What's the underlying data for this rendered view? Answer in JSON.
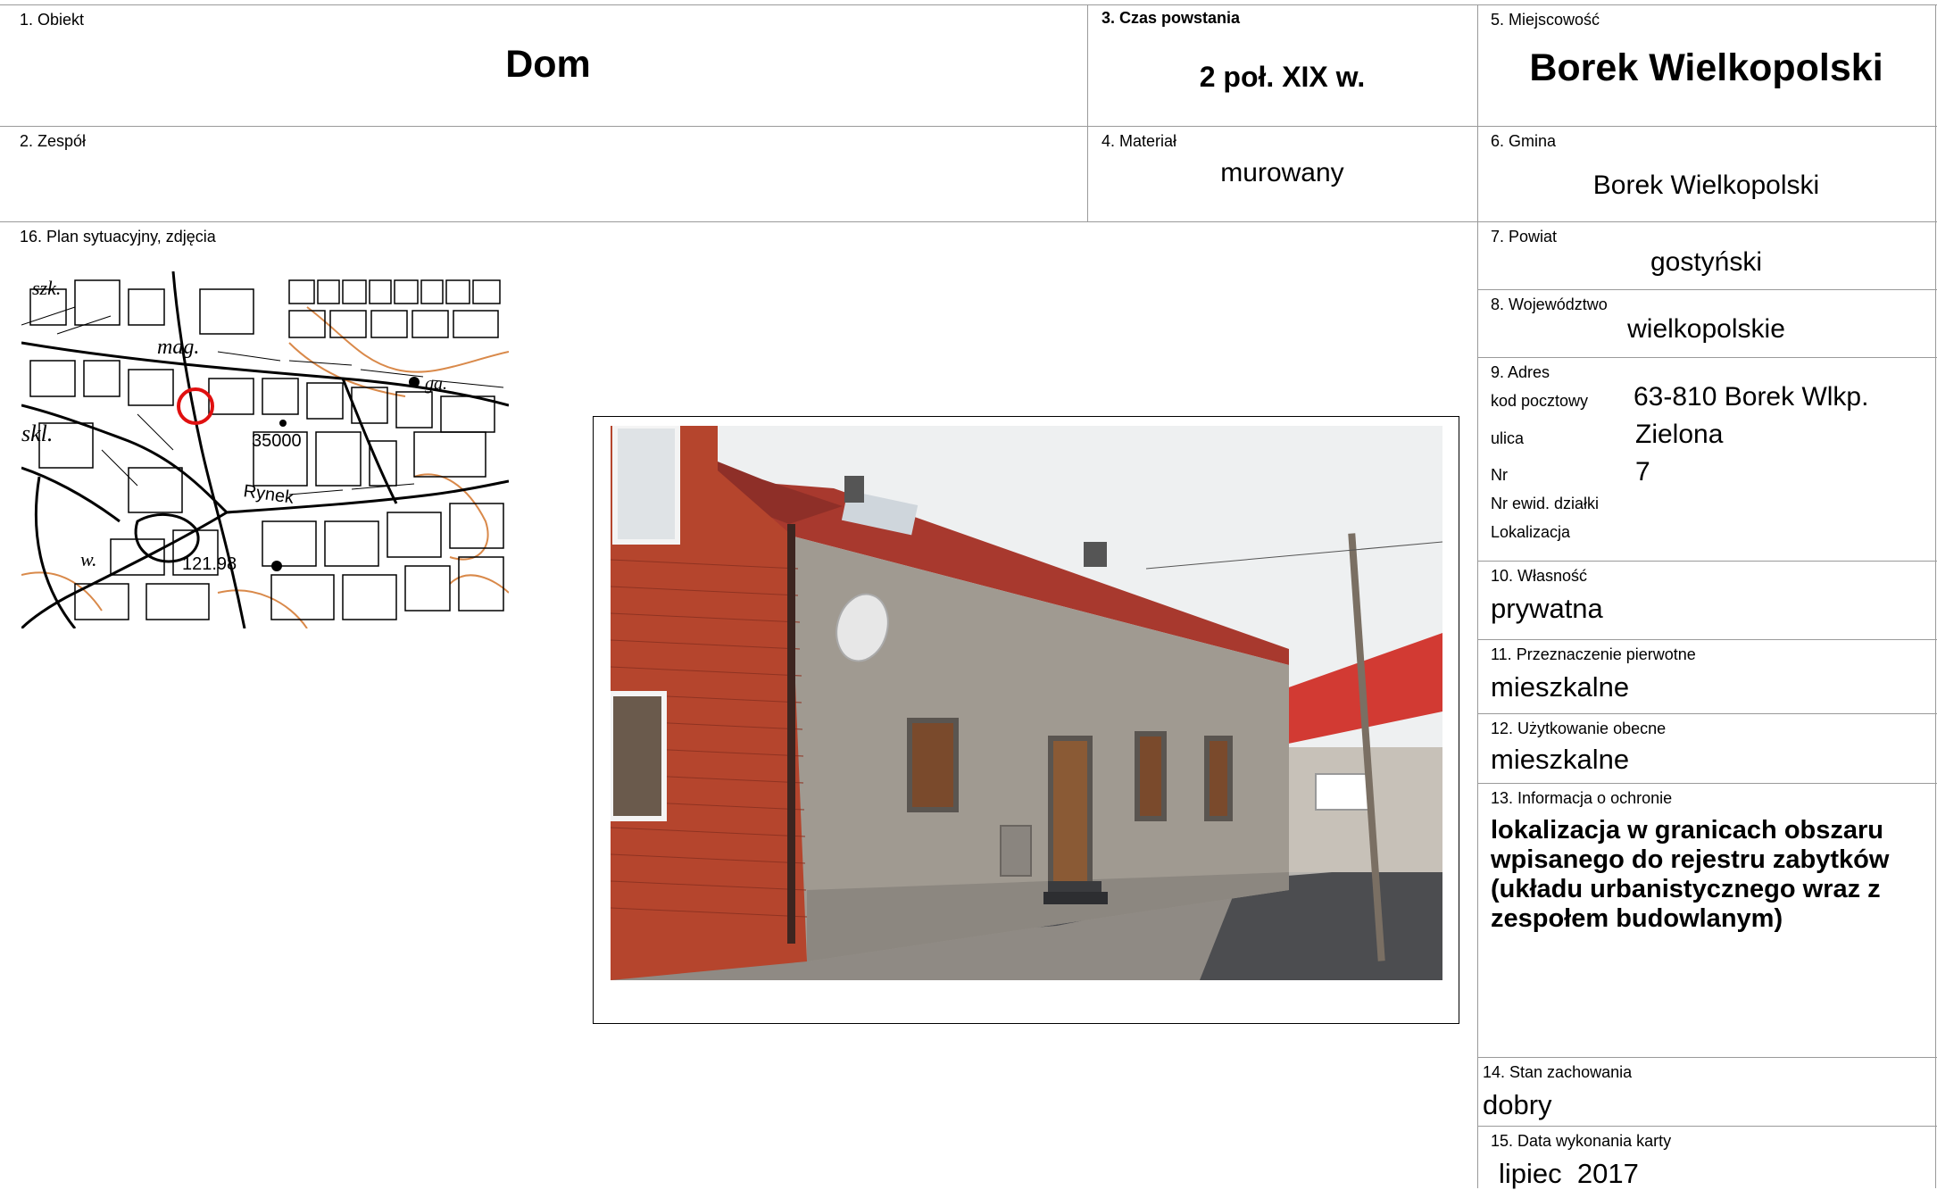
{
  "header": {
    "obiekt_label": "1. Obiekt",
    "obiekt_value": "Dom",
    "czas_label": "3. Czas powstania",
    "czas_value": "2 poł. XIX w.",
    "miejscowosc_label": "5. Miejscowość",
    "miejscowosc_value": "Borek Wielkopolski",
    "zespol_label": "2. Zespół",
    "zespol_value": "",
    "material_label": "4. Materiał",
    "material_value": "murowany",
    "gmina_label": "6. Gmina",
    "gmina_value": "Borek Wielkopolski"
  },
  "plan": {
    "label": "16. Plan sytuacyjny, zdjęcia",
    "map_labels": [
      "szk.",
      "mag.",
      "ga.",
      "skl.",
      "35000",
      "Rynek",
      "121.98",
      "w."
    ]
  },
  "right": {
    "powiat_label": "7. Powiat",
    "powiat_value": "gostyński",
    "wojewodztwo_label": "8. Województwo",
    "wojewodztwo_value": "wielkopolskie",
    "adres_label": "9. Adres",
    "kod_label": "kod pocztowy",
    "kod_value": "63-810 Borek Wlkp.",
    "ulica_label": "ulica",
    "ulica_value": "Zielona",
    "nr_label": "Nr",
    "nr_value": "7",
    "dzialka_label": "Nr ewid. działki",
    "lokalizacja_label": "Lokalizacja",
    "wlasnosc_label": "10. Własność",
    "wlasnosc_value": "prywatna",
    "przeznaczenie_label": "11. Przeznaczenie pierwotne",
    "przeznaczenie_value": "mieszkalne",
    "uzytkowanie_label": "12. Użytkowanie obecne",
    "uzytkowanie_value": "mieszkalne",
    "ochrona_label": "13. Informacja o ochronie",
    "ochrona_lines": [
      "lokalizacja w granicach obszaru",
      "wpisanego do rejestru zabytków",
      "(układu urbanistycznego wraz z",
      "zespołem budowlanym)"
    ],
    "stan_label": "14. Stan zachowania",
    "stan_value": "dobry",
    "data_label": "15. Data wykonania karty",
    "data_value": "lipiec  2017"
  },
  "colors": {
    "grid_line": "#9a9a9a",
    "marker_red": "#e01010",
    "roof_red": "#a8392e",
    "brick": "#b5452d",
    "render_grey": "#a09a91"
  }
}
